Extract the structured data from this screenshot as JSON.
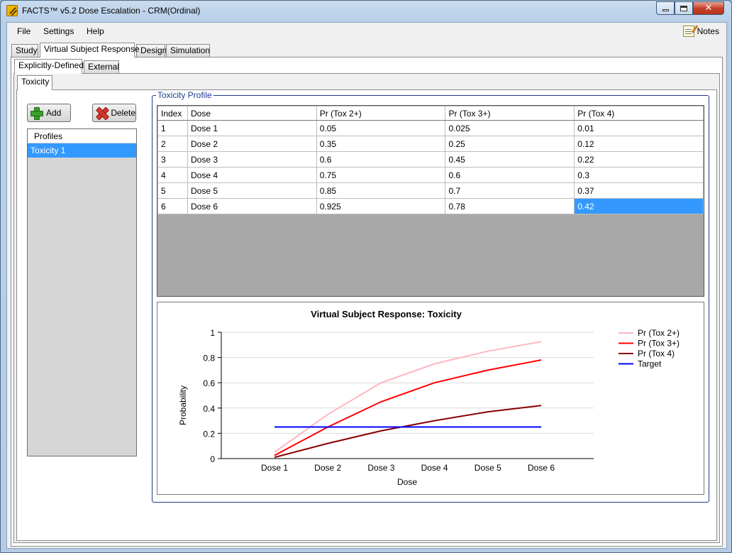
{
  "window": {
    "title": "FACTS™ v5.2 Dose Escalation - CRM(Ordinal)"
  },
  "menu": {
    "file": "File",
    "settings": "Settings",
    "help": "Help",
    "notes": "Notes"
  },
  "main_tabs": [
    "Study",
    "Virtual Subject Response",
    "Design",
    "Simulation"
  ],
  "sub_tabs": [
    "Explicitly-Defined",
    "External"
  ],
  "inner_tabs": [
    "Toxicity"
  ],
  "buttons": {
    "add": "Add",
    "delete": "Delete"
  },
  "profiles": {
    "header": "Profiles",
    "items": [
      "Toxicity 1"
    ]
  },
  "toxicity_profile": {
    "label": "Toxicity Profile",
    "columns": [
      "Index",
      "Dose",
      "Pr (Tox 2+)",
      "Pr (Tox 3+)",
      "Pr (Tox 4)"
    ],
    "rows": [
      [
        "1",
        "Dose 1",
        "0.05",
        "0.025",
        "0.01"
      ],
      [
        "2",
        "Dose 2",
        "0.35",
        "0.25",
        "0.12"
      ],
      [
        "3",
        "Dose 3",
        "0.6",
        "0.45",
        "0.22"
      ],
      [
        "4",
        "Dose 4",
        "0.75",
        "0.6",
        "0.3"
      ],
      [
        "5",
        "Dose 5",
        "0.85",
        "0.7",
        "0.37"
      ],
      [
        "6",
        "Dose 6",
        "0.925",
        "0.78",
        "0.42"
      ]
    ],
    "selected_cell": {
      "row": 5,
      "col": 4
    }
  },
  "chart_data": {
    "type": "line",
    "title": "Virtual Subject Response: Toxicity",
    "xlabel": "Dose",
    "ylabel": "Probability",
    "categories": [
      "Dose 1",
      "Dose 2",
      "Dose 3",
      "Dose 4",
      "Dose 5",
      "Dose 6"
    ],
    "ylim": [
      0,
      1
    ],
    "yticks": [
      0,
      0.2,
      0.4,
      0.6,
      0.8,
      1
    ],
    "ytick_labels": [
      "0",
      "0.2",
      "0.4",
      "0.6",
      "0.8",
      "1"
    ],
    "grid": true,
    "legend_position": "right",
    "series": [
      {
        "name": "Pr (Tox 2+)",
        "color": "#ffb6c1",
        "values": [
          0.05,
          0.35,
          0.6,
          0.75,
          0.85,
          0.925
        ]
      },
      {
        "name": "Pr (Tox 3+)",
        "color": "#ff0000",
        "values": [
          0.025,
          0.25,
          0.45,
          0.6,
          0.7,
          0.78
        ]
      },
      {
        "name": "Pr (Tox 4)",
        "color": "#8b0000",
        "values": [
          0.01,
          0.12,
          0.22,
          0.3,
          0.37,
          0.42
        ]
      },
      {
        "name": "Target",
        "color": "#0000ff",
        "values": [
          0.25,
          0.25,
          0.25,
          0.25,
          0.25,
          0.25
        ]
      }
    ]
  }
}
